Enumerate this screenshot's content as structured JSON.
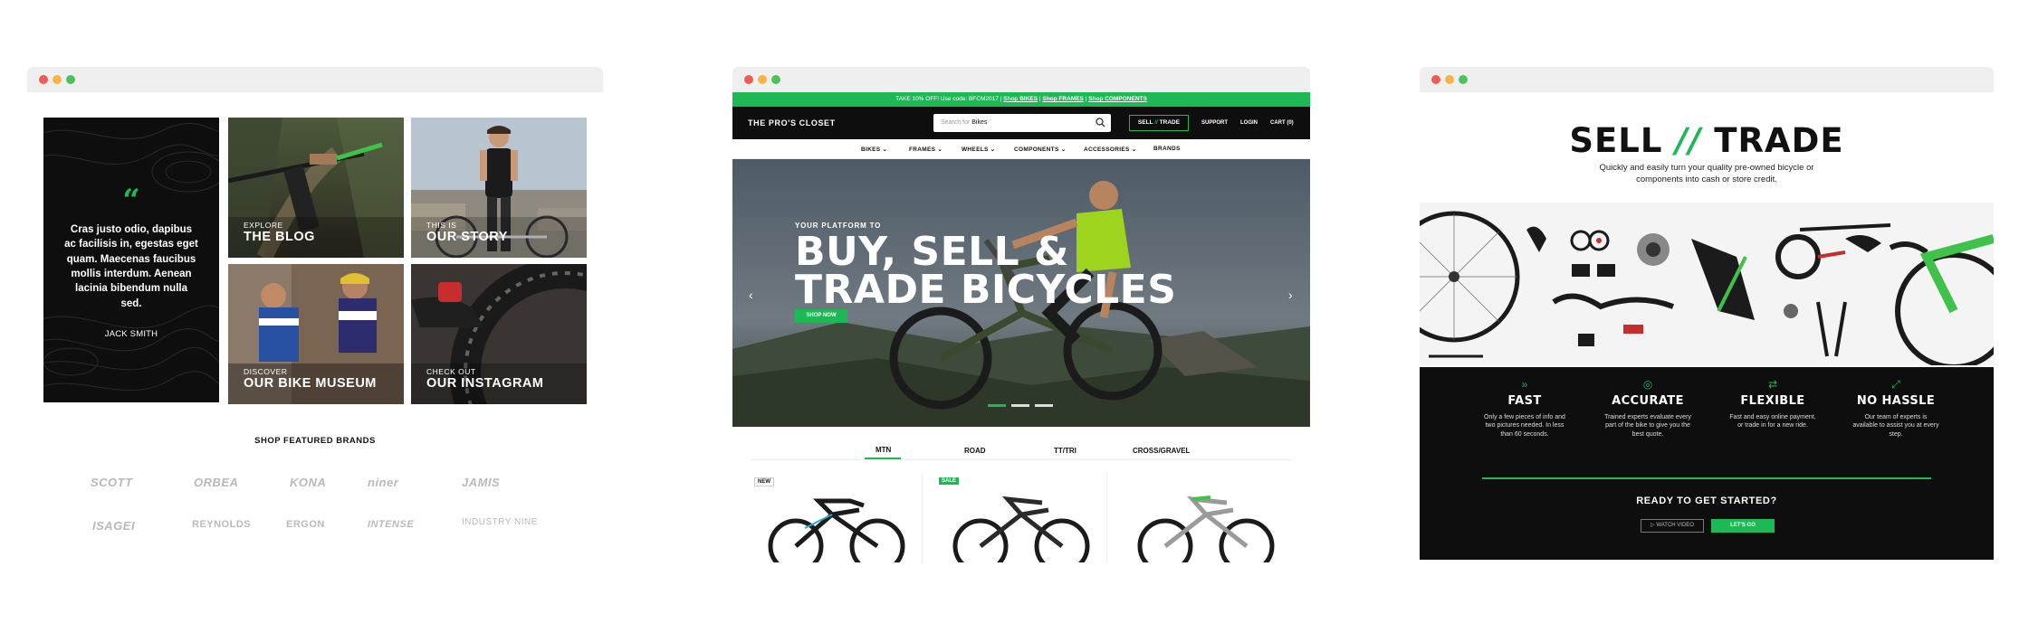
{
  "window1": {
    "quote": {
      "text": "Cras justo odio, dapibus ac facilisis in, egestas eget quam. Maecenas faucibus mollis interdum. Aenean lacinia bibendum nulla sed.",
      "author": "JACK SMITH",
      "icon": "quote-icon"
    },
    "tiles": [
      {
        "small": "EXPLORE",
        "big": "THE BLOG"
      },
      {
        "small": "THIS IS",
        "big": "OUR STORY"
      },
      {
        "small": "DISCOVER",
        "big": "OUR BIKE MUSEUM"
      },
      {
        "small": "CHECK OUT",
        "big": "OUR INSTAGRAM"
      }
    ],
    "brands_title": "SHOP FEATURED BRANDS",
    "brands": [
      "SCOTT",
      "ORBEA",
      "KONA",
      "niner",
      "JAMIS",
      "ISAGEI",
      "REYNOLDS",
      "ERGON",
      "INTENSE",
      "INDUSTRY NINE"
    ]
  },
  "window2": {
    "promo": {
      "prefix": "TAKE 10% OFF! Use code: BFCM2017",
      "bikes": "Shop BIKES",
      "frames": "Shop FRAMES",
      "components": "Shop COMPONENTS",
      "sep": " | "
    },
    "logo": "THE PRO'S CLOSET",
    "search": {
      "placeholder": "Search for",
      "value": "Bikes"
    },
    "sell_trade": {
      "left": "SELL",
      "slash": "//",
      "right": "TRADE"
    },
    "nav_links": [
      "SUPPORT",
      "LOGIN",
      "CART (0)"
    ],
    "menu": [
      "BIKES",
      "FRAMES",
      "WHEELS",
      "COMPONENTS",
      "ACCESSORIES",
      "BRANDS"
    ],
    "hero": {
      "eyebrow": "YOUR PLATFORM TO",
      "title": "BUY, SELL &\nTRADE BICYCLES",
      "button": "SHOP NOW",
      "prev": "‹",
      "next": "›"
    },
    "tabs": [
      "MTN",
      "ROAD",
      "TT/TRI",
      "CROSS/GRAVEL"
    ],
    "active_tab": "MTN",
    "badges": {
      "new": "NEW",
      "sale": "SALE"
    }
  },
  "window3": {
    "title_left": "SELL",
    "title_slash": "//",
    "title_right": "TRADE",
    "subtitle": "Quickly and easily turn your quality pre-owned bicycle or\ncomponents into cash or store credit.",
    "features": [
      {
        "icon": "fast-forward-icon",
        "title": "FAST",
        "text": "Only a few pieces of info and two pictures needed. In less than 60 seconds."
      },
      {
        "icon": "target-icon",
        "title": "ACCURATE",
        "text": "Trained experts evaluate every part of the bike to give you the best quote."
      },
      {
        "icon": "shuffle-icon",
        "title": "FLEXIBLE",
        "text": "Fast and easy online payment, or trade in for a new ride."
      },
      {
        "icon": "expand-icon",
        "title": "NO HASSLE",
        "text": "Our team of experts is available to assist you at every step."
      }
    ],
    "ready": "READY TO GET STARTED?",
    "watch": "WATCH VIDEO",
    "go": "LET'S GO"
  },
  "colors": {
    "accent": "#1db954",
    "dark": "#0e0e0e",
    "chrome": "#efefef"
  }
}
